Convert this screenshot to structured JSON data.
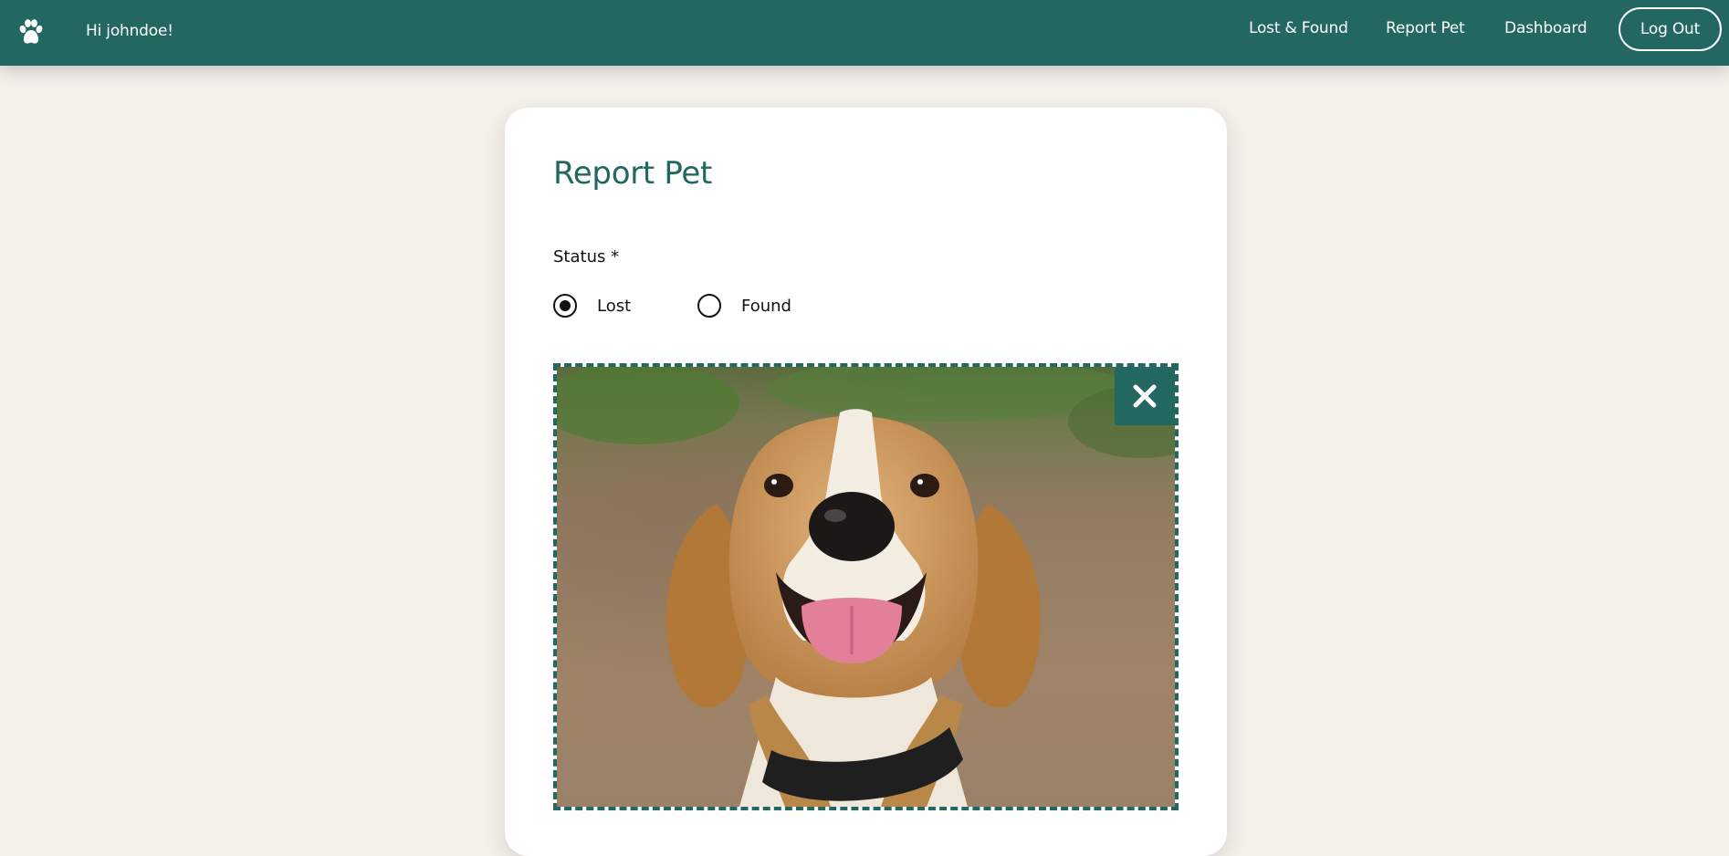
{
  "navbar": {
    "logo_icon": "paw-icon",
    "greeting": "Hi johndoe!",
    "links": [
      {
        "label": "Lost & Found"
      },
      {
        "label": "Report Pet"
      },
      {
        "label": "Dashboard"
      }
    ],
    "logout_label": "Log Out"
  },
  "form": {
    "title": "Report Pet",
    "status_label": "Status *",
    "options": [
      {
        "label": "Lost",
        "selected": true
      },
      {
        "label": "Found",
        "selected": false
      }
    ],
    "upload": {
      "remove_icon": "close-icon"
    }
  },
  "colors": {
    "primary": "#226861",
    "background": "#f4f1eb",
    "card": "#ffffff"
  }
}
